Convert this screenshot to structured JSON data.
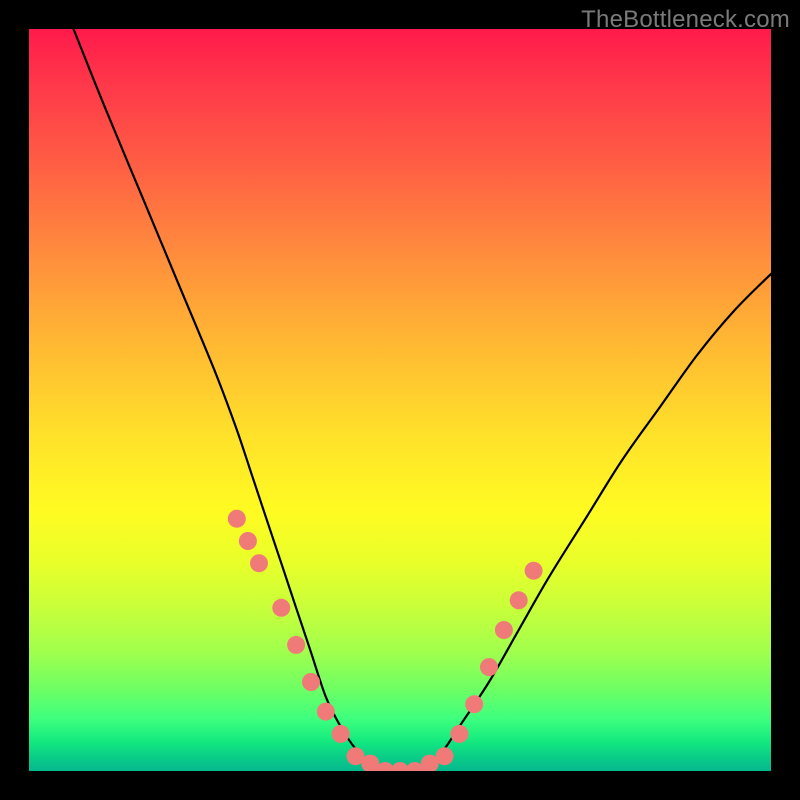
{
  "watermark": {
    "text": "TheBottleneck.com"
  },
  "colors": {
    "frame": "#000000",
    "curve": "#000000",
    "dot_fill": "#ef7a78",
    "dot_stroke": "#c65a58",
    "gradient_top": "#ff1a4b",
    "gradient_bottom": "#06b88e"
  },
  "chart_data": {
    "type": "line",
    "title": "",
    "xlabel": "",
    "ylabel": "",
    "xlim": [
      0,
      100
    ],
    "ylim": [
      0,
      100
    ],
    "grid": false,
    "legend": null,
    "series": [
      {
        "name": "bottleneck-curve",
        "x": [
          6,
          10,
          15,
          20,
          25,
          28,
          30,
          32,
          34,
          36,
          38,
          40,
          42,
          44,
          46,
          48,
          50,
          52,
          54,
          56,
          58,
          62,
          66,
          70,
          75,
          80,
          85,
          90,
          95,
          100
        ],
        "y": [
          100,
          90,
          78,
          66,
          54,
          46,
          40,
          34,
          28,
          22,
          16,
          10,
          6,
          3,
          1,
          0,
          0,
          0,
          1,
          3,
          6,
          12,
          19,
          26,
          34,
          42,
          49,
          56,
          62,
          67
        ]
      },
      {
        "name": "highlight-dots",
        "x": [
          28,
          29.5,
          31,
          34,
          36,
          38,
          40,
          42,
          44,
          46,
          48,
          50,
          52,
          54,
          56,
          58,
          60,
          62,
          64,
          66,
          68
        ],
        "y": [
          34,
          31,
          28,
          22,
          17,
          12,
          8,
          5,
          2,
          1,
          0,
          0,
          0,
          1,
          2,
          5,
          9,
          14,
          19,
          23,
          27
        ]
      }
    ]
  }
}
